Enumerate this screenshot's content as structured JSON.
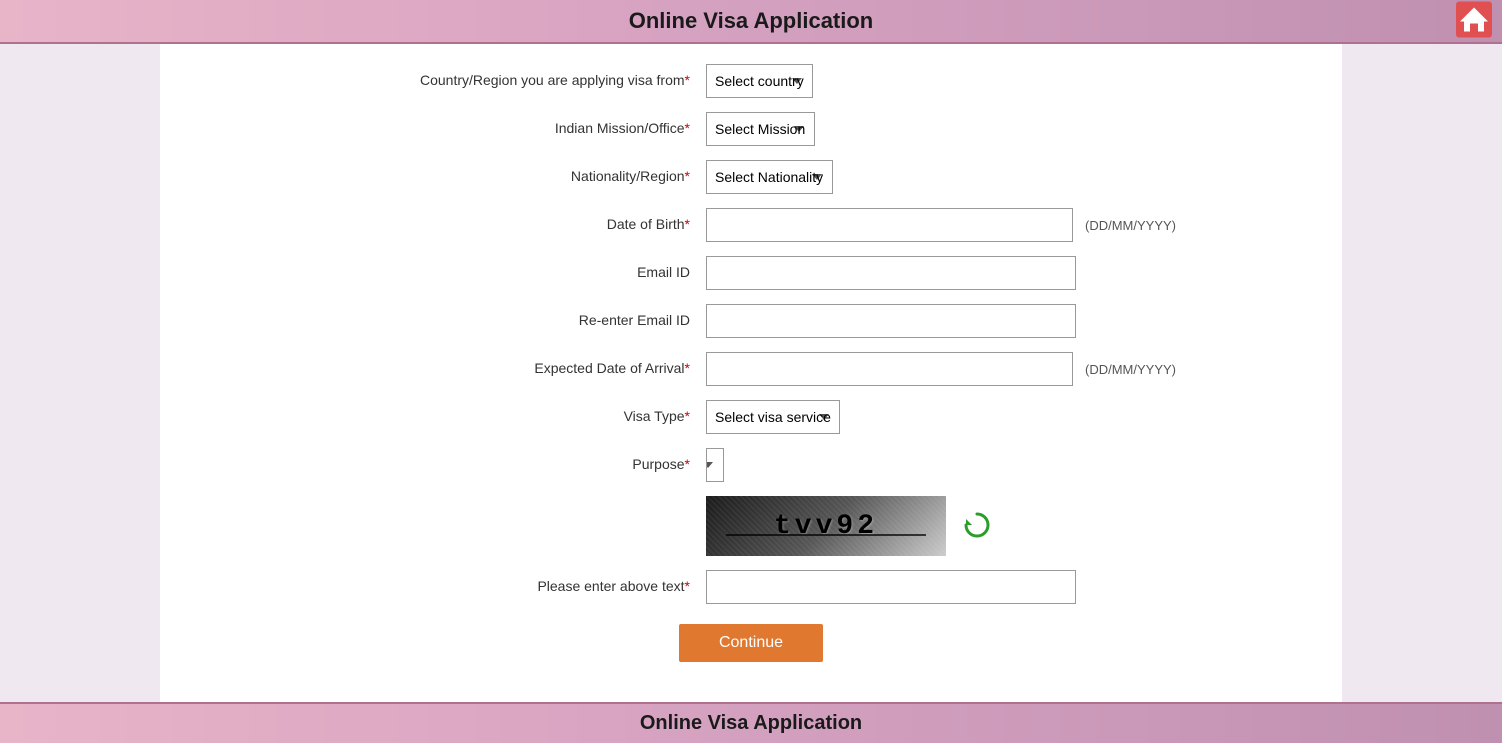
{
  "header": {
    "title": "Online Visa Application",
    "home_icon": "home-icon"
  },
  "footer": {
    "title": "Online Visa Application"
  },
  "form": {
    "fields": [
      {
        "label": "Country/Region you are applying visa from",
        "required": true,
        "type": "select",
        "placeholder": "Select country",
        "name": "country-region"
      },
      {
        "label": "Indian Mission/Office",
        "required": true,
        "type": "select",
        "placeholder": "Select Mission",
        "name": "indian-mission"
      },
      {
        "label": "Nationality/Region",
        "required": true,
        "type": "select",
        "placeholder": "Select Nationality",
        "name": "nationality"
      },
      {
        "label": "Date of Birth",
        "required": true,
        "type": "text",
        "placeholder": "",
        "hint": "(DD/MM/YYYY)",
        "name": "dob"
      },
      {
        "label": "Email ID",
        "required": false,
        "type": "text",
        "placeholder": "",
        "name": "email"
      },
      {
        "label": "Re-enter Email ID",
        "required": false,
        "type": "text",
        "placeholder": "",
        "name": "re-email"
      },
      {
        "label": "Expected Date of Arrival",
        "required": true,
        "type": "text",
        "placeholder": "",
        "hint": "(DD/MM/YYYY)",
        "name": "arrival-date"
      },
      {
        "label": "Visa Type",
        "required": true,
        "type": "select",
        "placeholder": "Select visa service",
        "name": "visa-type"
      },
      {
        "label": "Purpose",
        "required": true,
        "type": "select",
        "placeholder": "",
        "name": "purpose"
      }
    ],
    "captcha": {
      "text": "tvv92",
      "captcha_label": "Please enter above text",
      "captcha_required": true
    },
    "continue_button": "Continue"
  }
}
